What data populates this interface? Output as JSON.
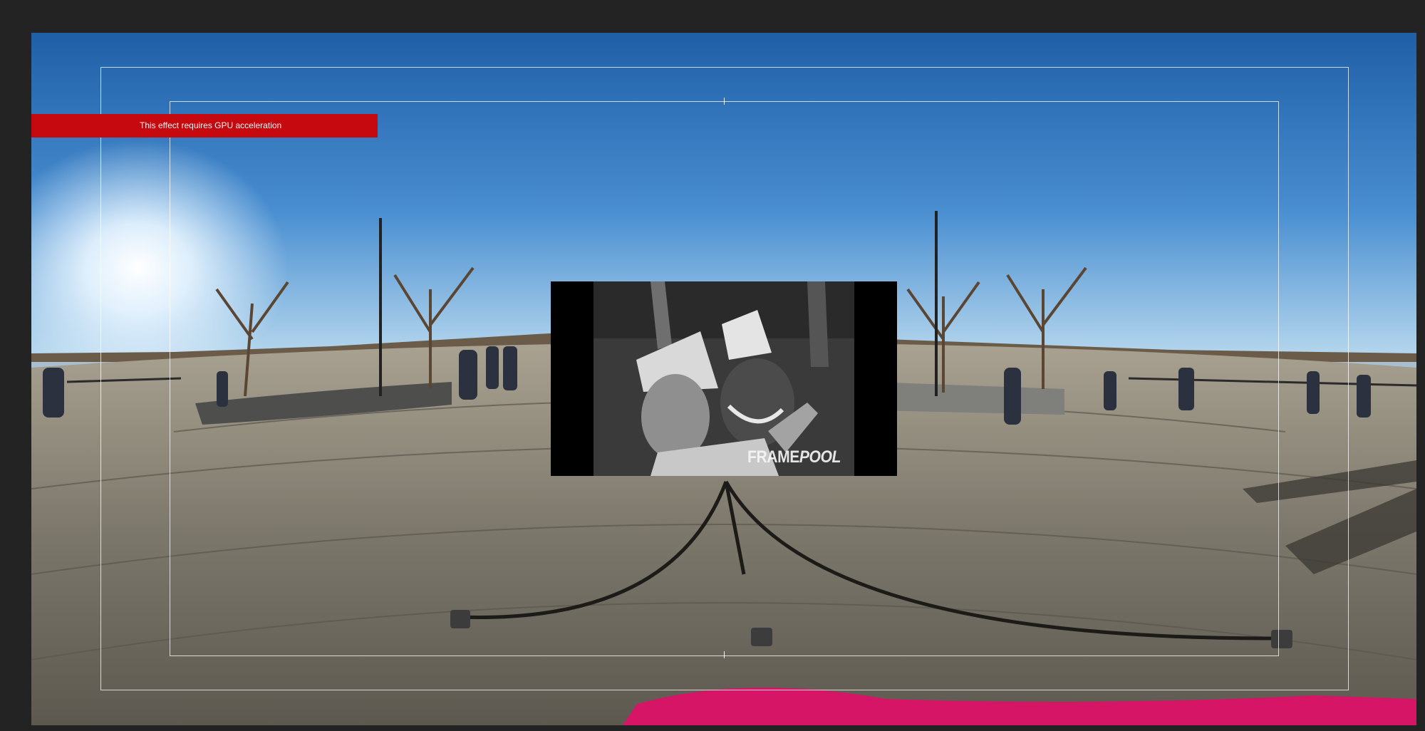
{
  "viewer": {
    "gpu_warning": "This effect requires GPU acceleration"
  },
  "clip": {
    "watermark_part1": "FRAME",
    "watermark_part2": "POOL"
  },
  "colors": {
    "app_background": "#232323",
    "warning_banner": "#c5090f",
    "guide_lines": "#ffffff"
  }
}
